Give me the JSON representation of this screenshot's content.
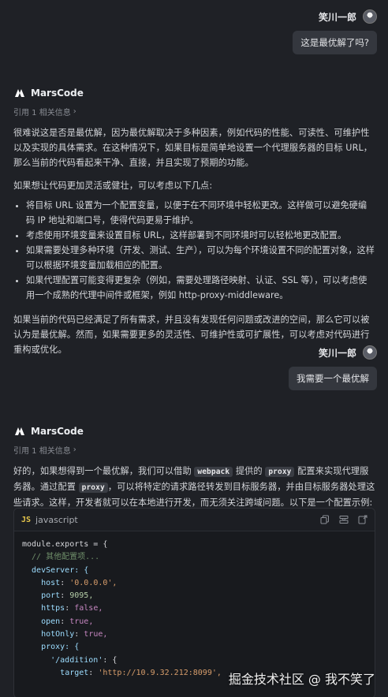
{
  "conversation": {
    "user_name": "笑川一郎",
    "bot_name": "MarsCode",
    "messages": [
      {
        "role": "user",
        "text": "这是最优解了吗?"
      },
      {
        "role": "assistant",
        "refs": "引用 1 相关信息",
        "intro": "很难说这是否是最优解，因为最优解取决于多种因素，例如代码的性能、可读性、可维护性以及实现的具体需求。在这种情况下，如果目标是简单地设置一个代理服务器的目标 URL，那么当前的代码看起来干净、直接，并且实现了预期的功能。",
        "lead": "如果想让代码更加灵活或健壮，可以考虑以下几点:",
        "points": [
          "将目标 URL 设置为一个配置变量，以便于在不同环境中轻松更改。这样做可以避免硬编码 IP 地址和端口号，使得代码更易于维护。",
          "考虑使用环境变量来设置目标 URL，这样部署到不同环境时可以轻松地更改配置。",
          "如果需要处理多种环境（开发、测试、生产），可以为每个环境设置不同的配置对象，这样可以根据环境变量加载相应的配置。",
          "如果代理配置可能变得更复杂（例如，需要处理路径映射、认证、SSL 等），可以考虑使用一个成熟的代理中间件或框架，例如 http-proxy-middleware。"
        ],
        "outro": "如果当前的代码已经满足了所有需求，并且没有发现任何问题或改进的空间，那么它可以被认为是最优解。然而，如果需要更多的灵活性、可维护性或可扩展性，可以考虑对代码进行重构或优化。"
      },
      {
        "role": "user",
        "text": "我需要一个最优解"
      },
      {
        "role": "assistant",
        "refs": "引用 1 相关信息",
        "p1_a": "好的，如果想得到一个最优解，我们可以借助",
        "code_webpack": "webpack",
        "p1_b": "提供的",
        "code_proxy": "proxy",
        "p1_c": "配置来实现代理服务器。通过配置",
        "code_proxy2": "proxy",
        "p1_d": "，可以将特定的请求路径转发到目标服务器，并由目标服务器处理这些请求。这样，开发者就可以在本地进行开发，而无须关注跨域问题。以下是一个配置示例:"
      }
    ]
  },
  "code_block": {
    "badge": "JS",
    "language": "javascript",
    "lines": [
      "module.exports = {",
      "  // 其他配置项...",
      "  devServer: {",
      "    host: '0.0.0.0',",
      "    port: 9095,",
      "    https: false,",
      "    open: true,",
      "    hotOnly: true,",
      "    proxy: {",
      "      '/addition': {",
      "        target: 'http://10.9.32.212:8099',"
    ]
  },
  "watermark": "掘金技术社区 @ 我不笑了",
  "colors": {
    "background": "#1f2126",
    "bubble": "#34373e",
    "code_bg": "#181a1e"
  }
}
